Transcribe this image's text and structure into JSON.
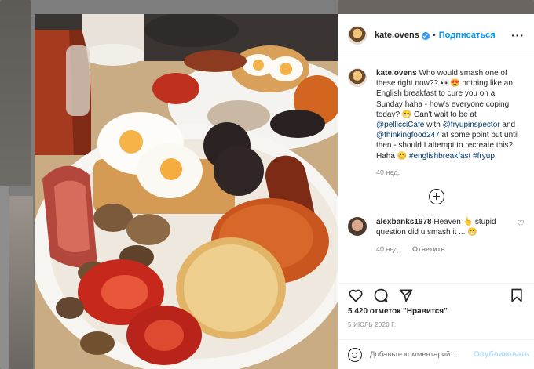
{
  "post": {
    "username": "kate.ovens",
    "follow_label": "Подписаться",
    "more_label": "···",
    "caption_user": "kate.ovens",
    "caption_p1": " Who would smash one of these right now?? 👀😍 nothing like an English breakfast to cure you on a Sunday haha - how's everyone coping today? 😁 Can't wait to be at ",
    "mention1": "@pellicciCafe",
    "caption_p2": " with ",
    "mention2": "@fryupinspector",
    "caption_p3": " and ",
    "mention3": "@thinkingfood247",
    "caption_p4": " at some point but until then - should I attempt to recreate this? Haha 😊 ",
    "hashtag1": "#englishbreakfast",
    "hashtag2": " #fryup",
    "caption_time": "40 нед."
  },
  "comment": {
    "username": "alexbanks1978",
    "text": " Heaven 👆 stupid question did u smash it ... 😁",
    "time": "40 нед.",
    "reply_label": "Ответить"
  },
  "stats": {
    "likes": "5 420 отметок \"Нравится\"",
    "date": "5 ИЮЛЬ 2020 Г."
  },
  "add_comment": {
    "placeholder": "Добавьте комментарий...",
    "publish_label": "Опубликовать"
  },
  "icons": {
    "heart": "heart-icon",
    "comment": "comment-icon",
    "share": "share-icon",
    "bookmark": "bookmark-icon",
    "emoji": "emoji-icon",
    "load_more": "load-more-icon"
  },
  "colors": {
    "accent": "#0095f6",
    "mention": "#00376b",
    "muted": "#8e8e8e",
    "text": "#262626"
  }
}
